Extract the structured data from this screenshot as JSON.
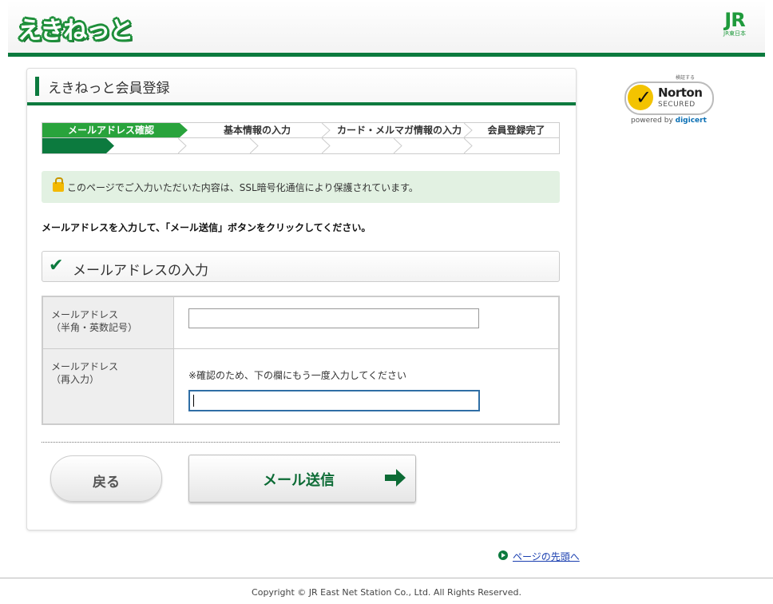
{
  "header": {
    "logo_text": "えきねっと",
    "jr_mark": "JR",
    "jr_sub": "JR東日本"
  },
  "norton": {
    "verify_text": "検証する",
    "name": "Norton",
    "secured": "SECURED",
    "powered_by": "powered by",
    "digicert": "digicert"
  },
  "panel": {
    "title": "えきねっと会員登録",
    "steps": [
      {
        "label": "メールアドレス確認",
        "active": true
      },
      {
        "label": "基本情報の入力",
        "active": false
      },
      {
        "label": "カード・メルマガ情報の入力",
        "active": false
      },
      {
        "label": "会員登録完了",
        "active": false
      }
    ],
    "progress_fraction": 0.125,
    "notice": "このページでご入力いただいた内容は、SSL暗号化通信により保護されています。",
    "instruction": "メールアドレスを入力して、「メール送信」ボタンをクリックしてください。",
    "section_title": "メールアドレスの入力",
    "form": {
      "email_label": "メールアドレス\n（半角・英数記号）",
      "email_value": "",
      "confirm_label": "メールアドレス\n（再入力）",
      "confirm_hint": "※確認のため、下の欄にもう一度入力してください",
      "confirm_value": ""
    },
    "back_label": "戻る",
    "send_label": "メール送信"
  },
  "footer": {
    "page_top": "ページの先頭へ",
    "copyright": "Copyright © JR East Net Station Co., Ltd. All Rights Reserved."
  },
  "colors": {
    "brand_green": "#0c7a3e",
    "active_step": "#29a33c",
    "notice_bg": "#e2f1e2",
    "link": "#1a3fb0"
  }
}
